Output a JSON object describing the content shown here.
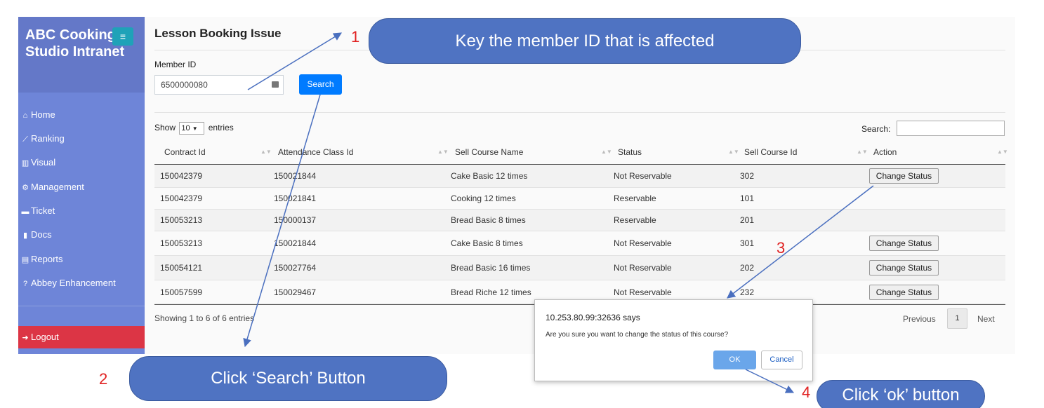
{
  "sidebar": {
    "brand": "ABC Cooking Studio Intranet",
    "menu_glyph": "≡",
    "items": [
      {
        "icon": "home-icon",
        "glyph": "⌂",
        "label": "Home"
      },
      {
        "icon": "chart-line-icon",
        "glyph": "⟋",
        "label": "Ranking"
      },
      {
        "icon": "bar-chart-icon",
        "glyph": "▥",
        "label": "Visual"
      },
      {
        "icon": "gear-icon",
        "glyph": "⚙",
        "label": "Management"
      },
      {
        "icon": "ticket-icon",
        "glyph": "▬",
        "label": "Ticket"
      },
      {
        "icon": "document-icon",
        "glyph": "▮",
        "label": "Docs"
      },
      {
        "icon": "report-icon",
        "glyph": "▤",
        "label": "Reports"
      },
      {
        "icon": "question-icon",
        "glyph": "?",
        "label": "Abbey Enhancement"
      }
    ],
    "logout": {
      "icon": "sign-out-icon",
      "glyph": "➜",
      "label": "Logout"
    }
  },
  "page": {
    "title": "Lesson Booking Issue",
    "member_label": "Member ID",
    "member_value": "6500000080",
    "search_button": "Search"
  },
  "table": {
    "show_prefix": "Show",
    "show_value": "10",
    "show_suffix": "entries",
    "search_label": "Search:",
    "headers": [
      "Contract Id",
      "Attendance Class Id",
      "Sell Course Name",
      "Status",
      "Sell Course Id",
      "Action"
    ],
    "rows": [
      {
        "contract": "150042379",
        "attendance": "150021844",
        "course": "Cake Basic 12 times",
        "status": "Not Reservable",
        "course_id": "302",
        "action": "Change Status"
      },
      {
        "contract": "150042379",
        "attendance": "150021841",
        "course": "Cooking 12 times",
        "status": "Reservable",
        "course_id": "101",
        "action": ""
      },
      {
        "contract": "150053213",
        "attendance": "150000137",
        "course": "Bread Basic 8 times",
        "status": "Reservable",
        "course_id": "201",
        "action": ""
      },
      {
        "contract": "150053213",
        "attendance": "150021844",
        "course": "Cake Basic 8 times",
        "status": "Not Reservable",
        "course_id": "301",
        "action": "Change Status"
      },
      {
        "contract": "150054121",
        "attendance": "150027764",
        "course": "Bread Basic 16 times",
        "status": "Not Reservable",
        "course_id": "202",
        "action": "Change Status"
      },
      {
        "contract": "150057599",
        "attendance": "150029467",
        "course": "Bread Riche 12 times",
        "status": "Not Reservable",
        "course_id": "232",
        "action": "Change Status"
      }
    ],
    "info": "Showing 1 to 6 of 6 entries",
    "prev": "Previous",
    "page": "1",
    "next": "Next"
  },
  "dialog": {
    "title": "10.253.80.99:32636 says",
    "message": "Are you sure you want to change the status of this course?",
    "ok": "OK",
    "cancel": "Cancel"
  },
  "callouts": {
    "step1": {
      "num": "1",
      "text": "Key the member ID that is affected"
    },
    "step2": {
      "num": "2",
      "text": "Click ‘Search’ Button"
    },
    "step3": {
      "num": "3"
    },
    "step4": {
      "num": "4",
      "text": "Click ‘ok’ button"
    }
  },
  "colors": {
    "sidebar": "#6e85d8",
    "brand_bg": "#6478c8",
    "logout": "#dc3545",
    "primary": "#007bff",
    "callout": "#4f73c2",
    "step_number": "#e02020"
  }
}
